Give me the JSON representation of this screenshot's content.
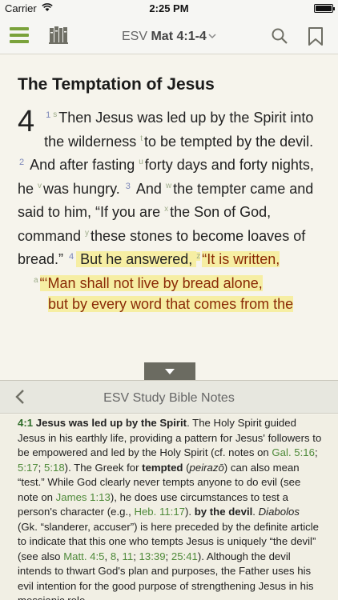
{
  "status": {
    "carrier": "Carrier",
    "time": "2:25 PM"
  },
  "toolbar": {
    "version": "ESV",
    "passage": "Mat 4:1-4",
    "icons": [
      "menu-icon",
      "library-icon",
      "chevron-down-icon",
      "search-icon",
      "bookmark-icon"
    ],
    "accent": "#7aa23b"
  },
  "reader": {
    "heading": "The Temptation of Jesus",
    "chapter": "4",
    "v1": "1",
    "fn_s": "s",
    "t1": "Then Jesus was led up by the Spirit into the wilderness ",
    "fn_t": "t",
    "t2": "to be tempted by the devil. ",
    "v2": "2",
    "t3": " And after fasting ",
    "fn_u": "u",
    "t4": "forty days and forty nights, he ",
    "fn_v": "v",
    "t5": "was hungry. ",
    "v3": "3",
    "t6": " And ",
    "fn_w": "w",
    "t7": "the tempter came and said to him, “If you are ",
    "fn_x": "x",
    "t8": "the Son of God, command ",
    "fn_y": "y",
    "t9": "these stones to become loaves of bread.” ",
    "v4": "4",
    "t10": " But he answered, ",
    "fn_z": "z",
    "t11": "“It is written,",
    "fn_a": "a",
    "p1": "“‘Man shall not live by bread alone,",
    "p2": "but by every word that comes from the"
  },
  "notes_panel": {
    "title": "ESV Study Bible Notes",
    "ref": "4:1",
    "lemma1": "Jesus was led up by the Spirit",
    "s1": ". The Holy Spirit guided Jesus in his earthly life, providing a pattern for Jesus' followers to be empowered and led by the Holy Spirit (cf. notes on ",
    "l1": "Gal. 5:16",
    "c1": "; ",
    "l2": "5:17",
    "c2": "; ",
    "l3": "5:18",
    "s2": "). The Greek for ",
    "b1": "tempted",
    "s3": " (",
    "i1": "peirazō",
    "s4": ") can also mean “test.” While God clearly never tempts anyone to do evil (see note on ",
    "l4": "James 1:13",
    "s5": "), he does use circumstances to test a person's character (e.g., ",
    "l5": "Heb. 11:17",
    "s6": "). ",
    "b2": "by the devil",
    "s7": ". ",
    "i2": "Diabolos",
    "s8": " (Gk. “slanderer, accuser”) is here preceded by the definite article to indicate that this one who tempts Jesus is uniquely “the devil” (see also ",
    "l6": "Matt. 4:5",
    "c3": ", ",
    "l7": "8",
    "c4": ", ",
    "l8": "11",
    "c5": "; ",
    "l9": "13:39",
    "c6": "; ",
    "l10": "25:41",
    "s9": "). Although the devil intends to thwart God's plan and purposes, the Father uses his evil intention for the good purpose of strengthening Jesus in his messianic role."
  }
}
